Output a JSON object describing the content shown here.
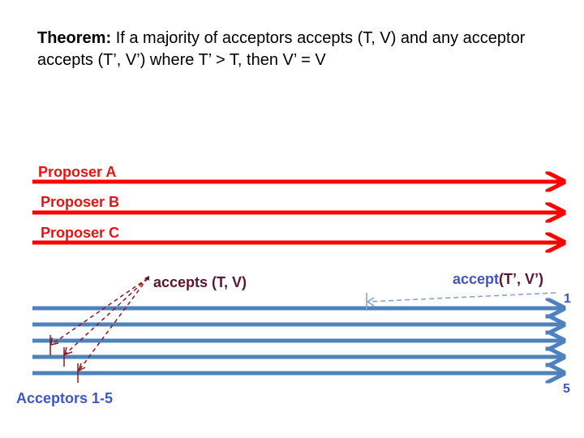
{
  "theorem": {
    "heading": "Theorem:",
    "text": "If a majority of acceptors accepts (T, V)  and any acceptor accepts (T’, V’) where T’ > T, then V’ = V"
  },
  "proposers": [
    {
      "label": "Proposer A"
    },
    {
      "label": "Proposer B"
    },
    {
      "label": "Proposer C"
    }
  ],
  "acceptors": {
    "label": "Acceptors 1-5",
    "first_index": "1",
    "last_index": "5"
  },
  "annotations": {
    "accepts_tv": "accepts (T, V)",
    "accept_word": "accept",
    "accept_args": "(T’, V’)"
  },
  "colors": {
    "proposer": "#ff0000",
    "acceptor": "#4f81bd",
    "accept_dashed": "#8b1a1a",
    "later_accept_dashed": "#7f9fcf",
    "label_blue": "#3f56c4"
  }
}
